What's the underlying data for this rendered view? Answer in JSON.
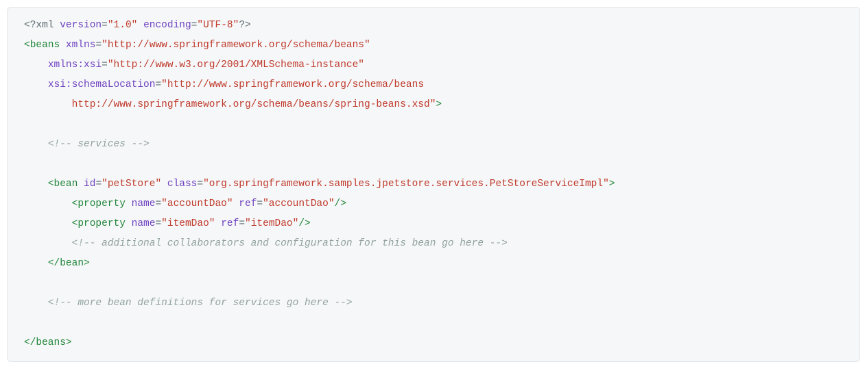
{
  "xml_decl": {
    "start": "<?xml",
    "version_attr": "version",
    "version_val": "\"1.0\"",
    "encoding_attr": "encoding",
    "encoding_val": "\"UTF-8\"",
    "end": "?>"
  },
  "beans_open": {
    "tag_open": "<beans",
    "xmlns_attr": "xmlns",
    "xmlns_val": "\"http://www.springframework.org/schema/beans\"",
    "xsi_attr": "xmlns:xsi",
    "xsi_val": "\"http://www.w3.org/2001/XMLSchema-instance\"",
    "loc_attr": "xsi:schemaLocation",
    "loc_val_line1": "\"http://www.springframework.org/schema/beans",
    "loc_val_line2": "http://www.springframework.org/schema/beans/spring-beans.xsd\"",
    "close_angle": ">"
  },
  "comment_services": "<!-- services -->",
  "bean": {
    "open": "<bean",
    "id_attr": "id",
    "id_val": "\"petStore\"",
    "class_attr": "class",
    "class_val": "\"org.springframework.samples.jpetstore.services.PetStoreServiceImpl\"",
    "open_close": ">",
    "prop1_open": "<property",
    "prop1_name_attr": "name",
    "prop1_name_val": "\"accountDao\"",
    "prop1_ref_attr": "ref",
    "prop1_ref_val": "\"accountDao\"",
    "prop1_close": "/>",
    "prop2_open": "<property",
    "prop2_name_attr": "name",
    "prop2_name_val": "\"itemDao\"",
    "prop2_ref_attr": "ref",
    "prop2_ref_val": "\"itemDao\"",
    "prop2_close": "/>",
    "comment_inner": "<!-- additional collaborators and configuration for this bean go here -->",
    "close_tag": "</bean>"
  },
  "comment_more": "<!-- more bean definitions for services go here -->",
  "beans_close": "</beans>"
}
